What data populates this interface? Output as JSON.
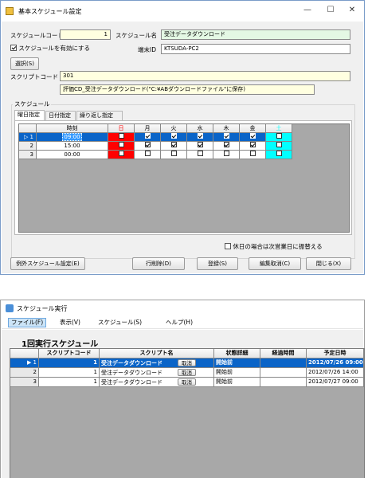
{
  "win1": {
    "title": "基本スケジュール設定",
    "controls": {
      "minimize": "—",
      "maximize": "☐",
      "close": "✕"
    },
    "schedule_code_label": "スケジュールコード",
    "schedule_code_value": "1",
    "schedule_name_label": "スケジュール名",
    "schedule_name_value": "受注データダウンロード",
    "enable_label": "スケジュールを有効にする",
    "terminal_id_label": "端末ID",
    "terminal_id_value": "KTSUDA-PC2",
    "select_button": "選択(S)",
    "script_code_label": "スクリプトコード",
    "script_code_value": "301",
    "script_desc_value": "評価CD_受注データダウンロード(\"C:¥ABダウンロードファイル\"に保存)",
    "schedule_group_label": "スケジュール",
    "tabs": [
      "曜日指定",
      "日付指定",
      "繰り返し指定"
    ],
    "grid": {
      "columns": [
        "時刻",
        "日",
        "月",
        "火",
        "水",
        "木",
        "金",
        "土"
      ],
      "rows": [
        {
          "num": "1",
          "time": "09:00",
          "days": [
            false,
            true,
            true,
            true,
            true,
            true,
            false
          ]
        },
        {
          "num": "2",
          "time": "15:00",
          "days": [
            false,
            true,
            true,
            true,
            true,
            true,
            false
          ]
        },
        {
          "num": "3",
          "time": "00:00",
          "days": [
            false,
            false,
            false,
            false,
            false,
            false,
            false
          ]
        }
      ]
    },
    "holiday_label": "休日の場合は次営業日に振替える",
    "buttons": {
      "exception": "例外スケジュール設定(E)",
      "delete_row": "行削除(D)",
      "register": "登録(S)",
      "cancel_edit": "編集取消(C)",
      "close": "閉じる(X)"
    },
    "colors": {
      "sunday": "#ff0000",
      "saturday": "#00ffff",
      "selection": "#0a64c8"
    }
  },
  "win2": {
    "title": "スケジュール実行",
    "menu": [
      "ファイル(F)",
      "表示(V)",
      "スケジュール(S)",
      "ヘルプ(H)"
    ],
    "heading": "1回実行スケジュール",
    "columns": [
      "スクリプトコード",
      "スクリプト名",
      "状態詳細",
      "経過時間",
      "予定日時"
    ],
    "cancel_label": "取消",
    "rows": [
      {
        "num": "1",
        "code": "1",
        "name": "受注データダウンロード",
        "status": "開始前",
        "elapsed": "",
        "scheduled": "2012/07/26 09:00"
      },
      {
        "num": "2",
        "code": "1",
        "name": "受注データダウンロード",
        "status": "開始前",
        "elapsed": "",
        "scheduled": "2012/07/26 14:00"
      },
      {
        "num": "3",
        "code": "1",
        "name": "受注データダウンロード",
        "status": "開始前",
        "elapsed": "",
        "scheduled": "2012/07/27 09:00"
      }
    ]
  }
}
